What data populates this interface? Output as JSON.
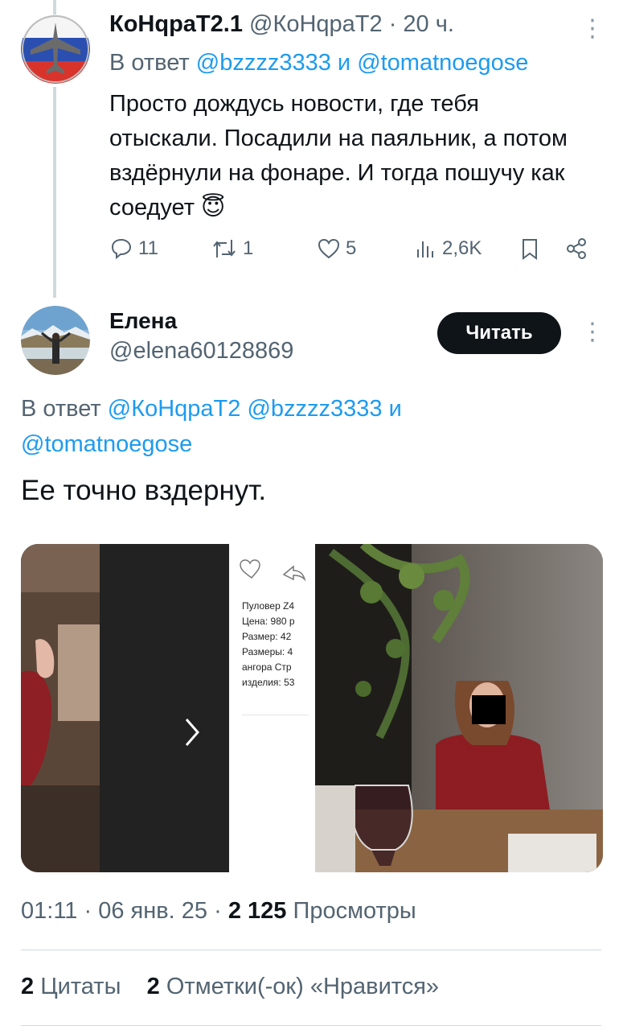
{
  "tweet1": {
    "display_name": "КоНqраТ2.1",
    "handle": "@КоНqраТ2",
    "time": "· 20 ч.",
    "reply_prefix": "В ответ",
    "reply_mention1": "@bzzzz3333",
    "reply_and": "и",
    "reply_mention2": "@tomatnoegose",
    "text": "Просто дождусь новости, где тебя отыскали. Посадили на паяльник, а потом вздёрнули на фонаре. И тогда пошучу как соедует 😇",
    "replies": "11",
    "reposts": "1",
    "likes": "5",
    "views": "2,6K",
    "avatar_icon": "airplane-peace-icon"
  },
  "tweet2": {
    "display_name": "Елена",
    "handle": "@elena60128869",
    "follow_label": "Читать",
    "reply_prefix": "В ответ",
    "reply_mention1": "@КоНqраТ2",
    "reply_mention2": "@bzzzz3333",
    "reply_and": "и",
    "reply_mention3": "@tomatnoegose",
    "text": "Ее точно вздернут.",
    "media": {
      "product_lines": [
        "Пуловер Z4",
        "Цена: 980 р",
        "Размер: 42",
        "Размеры: 4",
        "ангора Стр",
        "изделия: 53"
      ]
    },
    "time": "01:11",
    "date": "06 янв. 25",
    "sep": "·",
    "views_count": "2 125",
    "views_label": "Просмотры",
    "quotes_count": "2",
    "quotes_label": "Цитаты",
    "likes_count": "2",
    "likes_label": "Отметки(-ок) «Нравится»"
  },
  "colors": {
    "link": "#1d9bf0",
    "muted": "#536471",
    "text": "#0f1419",
    "divider": "#cfd9de"
  }
}
